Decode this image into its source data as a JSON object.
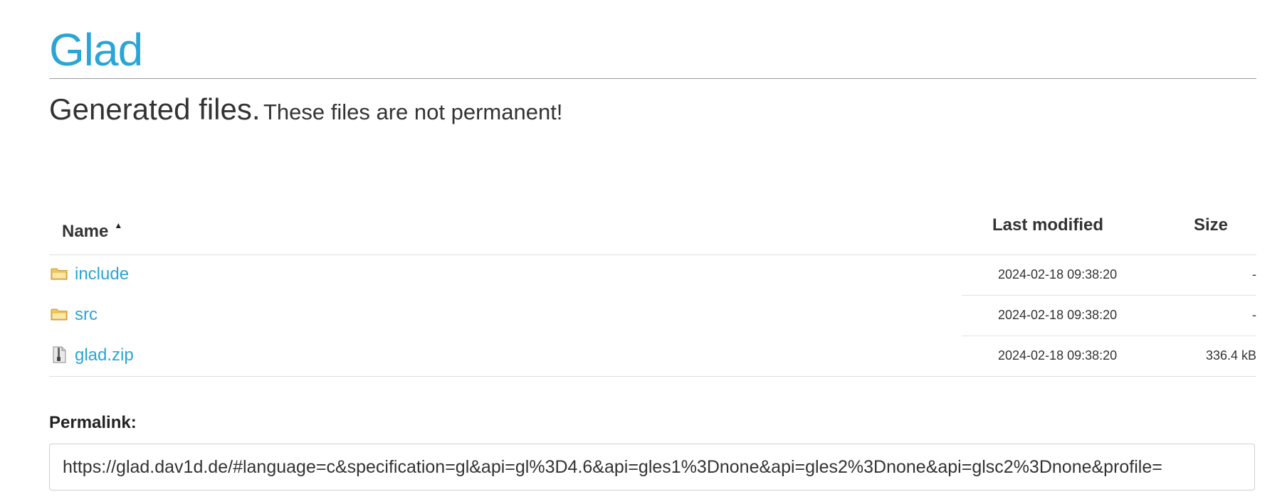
{
  "header": {
    "title": "Glad",
    "subtitle_main": "Generated files.",
    "subtitle_note": "These files are not permanent!"
  },
  "table": {
    "columns": {
      "name": "Name",
      "modified": "Last modified",
      "size": "Size"
    },
    "sort_indicator": "▲",
    "rows": [
      {
        "name": "include",
        "icon": "folder-icon",
        "modified": "2024-02-18 09:38:20",
        "size": "-"
      },
      {
        "name": "src",
        "icon": "folder-icon",
        "modified": "2024-02-18 09:38:20",
        "size": "-"
      },
      {
        "name": "glad.zip",
        "icon": "zip-file-icon",
        "modified": "2024-02-18 09:38:20",
        "size": "336.4 kB"
      }
    ]
  },
  "permalink": {
    "label": "Permalink:",
    "value": "https://glad.dav1d.de/#language=c&specification=gl&api=gl%3D4.6&api=gles1%3Dnone&api=gles2%3Dnone&api=glsc2%3Dnone&profile="
  },
  "colors": {
    "accent": "#2aa5d6",
    "folder": "#f0c040",
    "text": "#333333"
  }
}
